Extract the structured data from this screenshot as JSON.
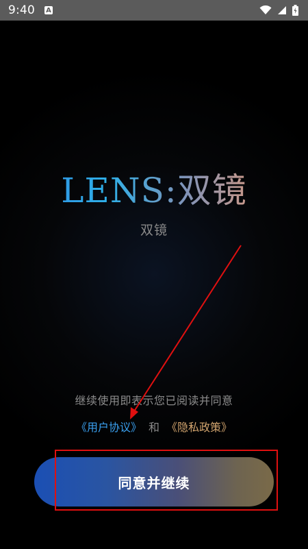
{
  "status_bar": {
    "time": "9:40",
    "notification_badge": "A"
  },
  "app": {
    "title": "LENS:双镜",
    "subtitle": "双镜"
  },
  "agreement": {
    "prompt": "继续使用即表示您已阅读并同意",
    "user_agreement": "《用户协议》",
    "and": "和",
    "privacy_policy": "《隐私政策》"
  },
  "button": {
    "agree_label": "同意并继续"
  },
  "colors": {
    "annotation": "#e01010",
    "user_link": "#3aa0f0",
    "privacy_link": "#d2a46e"
  }
}
